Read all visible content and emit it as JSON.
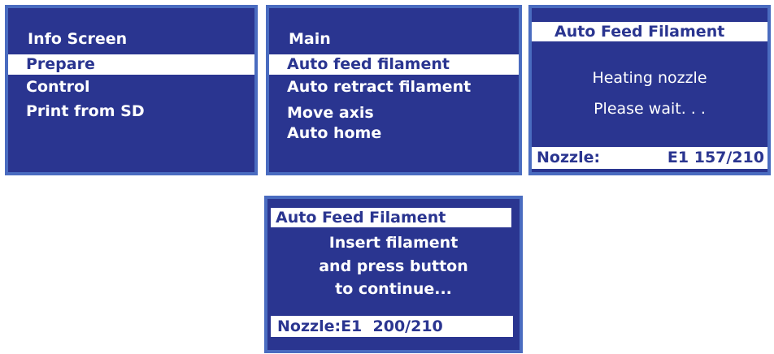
{
  "colors": {
    "screen_bg": "#2a3590",
    "border": "#4a6cc0",
    "highlight": "#ffffff"
  },
  "screen1": {
    "title": "Info Screen",
    "items": [
      "Prepare",
      "Control",
      "Print from SD"
    ]
  },
  "screen2": {
    "title": "Main",
    "items": [
      "Auto feed filament",
      "Auto retract filament",
      "Move axis",
      "Auto home"
    ]
  },
  "screen3": {
    "title": "Auto Feed Filament",
    "message_line1": "Heating nozzle",
    "message_line2": "Please wait. . .",
    "status_label": "Nozzle:",
    "status_value": "E1 157/210"
  },
  "screen4": {
    "title": "Auto Feed Filament",
    "message_line1": "Insert filament",
    "message_line2": "and press button",
    "message_line3": "to continue...",
    "status": "Nozzle:E1  200/210"
  }
}
